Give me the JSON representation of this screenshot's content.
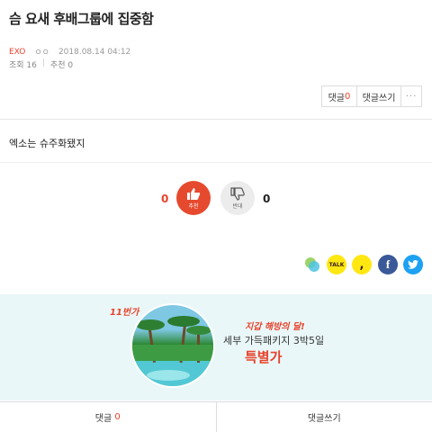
{
  "post": {
    "title": "슴 요새 후배그룹에 집중함",
    "category": "EXO",
    "author": "ㅇㅇ",
    "date": "2018.08.14 04:12",
    "views_label": "조회 16",
    "recommend_label": "추천 0",
    "body": "엑소는 슈주화됐지"
  },
  "actions": {
    "comment_label": "댓글",
    "comment_count": "0",
    "write_label": "댓글쓰기",
    "more_label": "···"
  },
  "vote": {
    "up_count": "0",
    "up_label": "추천",
    "down_count": "0",
    "down_label": "반대"
  },
  "share": {
    "icons": [
      "band-icon",
      "kakaotalk-icon",
      "kakaostory-icon",
      "facebook-icon",
      "twitter-icon"
    ],
    "talk_label": "TALK",
    "colors": {
      "kakao": "#ffe812",
      "facebook": "#3b5998",
      "twitter": "#1da1f2"
    }
  },
  "banner": {
    "brand": "11번가",
    "headline": "지갑 해방의 달!",
    "subline": "세부 가득패키지 3박5일",
    "price_label": "특별가"
  },
  "bottom": {
    "comment_label": "댓글",
    "comment_count": "0",
    "write_label": "댓글쓰기"
  },
  "colors": {
    "accent": "#e8432c"
  }
}
